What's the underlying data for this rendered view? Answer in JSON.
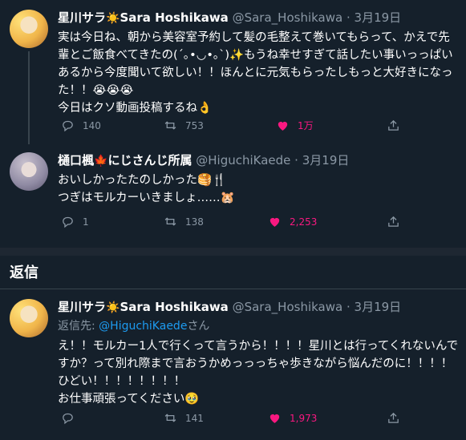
{
  "tweets": [
    {
      "name": "星川サラ",
      "name_emoji": "☀️",
      "name_latin": "Sara Hoshikawa",
      "handle": "@Sara_Hoshikawa",
      "date": "3月19日",
      "text": "実は今日ね、朝から美容室予約して髪の毛整えて巻いてもらって、かえで先輩とご飯食べてきたの(´｡•◡•｡`)✨もうね幸せすぎて話したい事いっっぱいあるから今度聞いて欲しい！！ほんとに元気もらったしもっと大好きになった！！😭😭😭\n今日はクソ動画投稿するね👌",
      "replies": "140",
      "retweets": "753",
      "likes": "1万"
    },
    {
      "name": "樋口楓",
      "name_emoji": "🍁",
      "name_latin": "にじさんじ所属",
      "handle": "@HiguchiKaede",
      "date": "3月19日",
      "text": "おいしかったたのしかった🥞🍴\nつぎはモルカーいきましょ……🐹",
      "replies": "1",
      "retweets": "138",
      "likes": "2,253"
    }
  ],
  "section": {
    "title": "返信"
  },
  "reply": {
    "name": "星川サラ",
    "name_emoji": "☀️",
    "name_latin": "Sara Hoshikawa",
    "handle": "@Sara_Hoshikawa",
    "date": "3月19日",
    "reply_prefix": "返信先:",
    "reply_handle": "@HiguchiKaede",
    "reply_suffix": "さん",
    "text": "え！！モルカー1人で行くって言うから！！！！星川とは行ってくれないんですか？って別れ際まで言おうかめっっっちゃ歩きながら悩んだのに！！！！ひどい！！！！！！！！\nお仕事頑張ってください🥹",
    "replies": "",
    "retweets": "141",
    "likes": "1,973"
  },
  "colors": {
    "accent": "#1d9bf0",
    "like": "#f91880",
    "background": "#15202b"
  },
  "icons": [
    "reply-icon",
    "retweet-icon",
    "like-icon",
    "share-icon"
  ]
}
